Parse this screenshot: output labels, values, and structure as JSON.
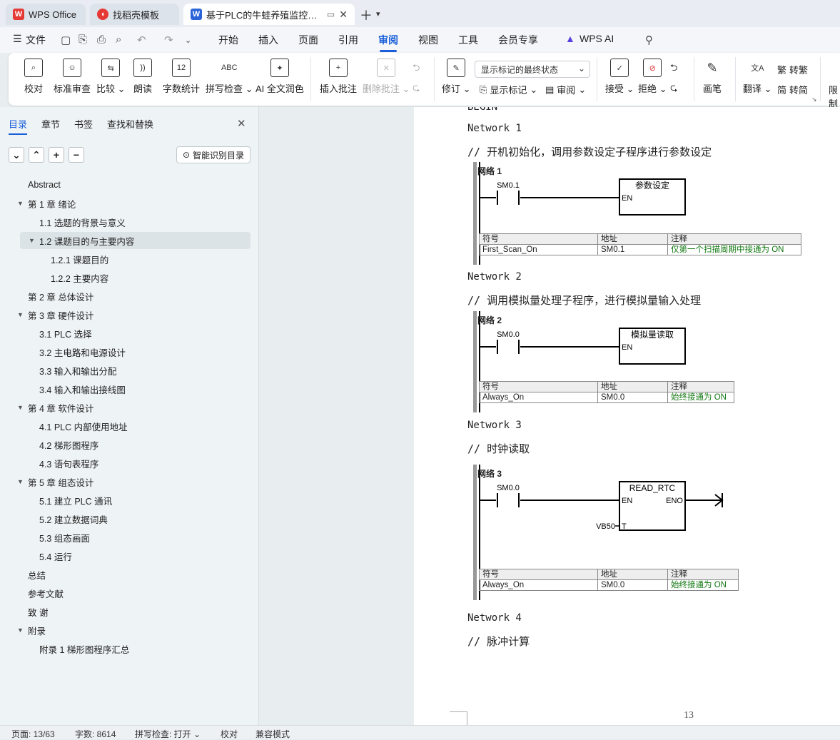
{
  "tabs": [
    {
      "label": "WPS Office"
    },
    {
      "label": "找稻壳模板"
    },
    {
      "label": "基于PLC的牛蛙养殖监控系统"
    }
  ],
  "menu": {
    "file": "文件",
    "items": [
      "开始",
      "插入",
      "页面",
      "引用",
      "审阅",
      "视图",
      "工具",
      "会员专享"
    ],
    "ai": "WPS AI",
    "active": "审阅"
  },
  "ribbon": {
    "proofread": "校对",
    "std_review": "标准审查",
    "compare": "比较",
    "read_aloud": "朗读",
    "word_count": "字数统计",
    "spell_check": "拼写检查",
    "ai_polish": "AI 全文润色",
    "insert_comment": "插入批注",
    "delete_comment": "删除批注",
    "markup_dropdown": "显示标记的最终状态",
    "revise": "修订",
    "show_markup": "显示标记",
    "review": "审阅",
    "accept": "接受",
    "reject": "拒绝",
    "pen": "画笔",
    "translate": "翻译",
    "to_traditional": "转繁",
    "to_simplified": "转简",
    "restrict": "限制"
  },
  "panel": {
    "tabs": [
      "目录",
      "章节",
      "书签",
      "查找和替换"
    ],
    "smart_btn": "智能识别目录",
    "toc": [
      {
        "label": "Abstract",
        "level": 0,
        "arrow": ""
      },
      {
        "label": "第 1 章  绪论",
        "level": 0,
        "arrow": "▼"
      },
      {
        "label": "1.1  选题的背景与意义",
        "level": 1,
        "arrow": ""
      },
      {
        "label": "1.2  课题目的与主要内容",
        "level": 1,
        "arrow": "▼",
        "selected": true
      },
      {
        "label": "1.2.1  课题目的",
        "level": 2,
        "arrow": ""
      },
      {
        "label": "1.2.2  主要内容",
        "level": 2,
        "arrow": ""
      },
      {
        "label": "第 2 章    总体设计",
        "level": 0,
        "arrow": ""
      },
      {
        "label": "第 3 章    硬件设计",
        "level": 0,
        "arrow": "▼"
      },
      {
        "label": "3.1 PLC 选择",
        "level": 1,
        "arrow": ""
      },
      {
        "label": "3.2  主电路和电源设计",
        "level": 1,
        "arrow": ""
      },
      {
        "label": "3.3  输入和输出分配",
        "level": 1,
        "arrow": ""
      },
      {
        "label": "3.4  输入和输出接线图",
        "level": 1,
        "arrow": ""
      },
      {
        "label": "第 4 章    软件设计",
        "level": 0,
        "arrow": "▼"
      },
      {
        "label": "4.1 PLC 内部使用地址",
        "level": 1,
        "arrow": ""
      },
      {
        "label": "4.2  梯形图程序",
        "level": 1,
        "arrow": ""
      },
      {
        "label": "4.3  语句表程序",
        "level": 1,
        "arrow": ""
      },
      {
        "label": "第 5 章    组态设计",
        "level": 0,
        "arrow": "▼"
      },
      {
        "label": "5.1 建立 PLC 通讯",
        "level": 1,
        "arrow": ""
      },
      {
        "label": "5.2  建立数据词典",
        "level": 1,
        "arrow": ""
      },
      {
        "label": "5.3  组态画面",
        "level": 1,
        "arrow": ""
      },
      {
        "label": "5.4 运行",
        "level": 1,
        "arrow": ""
      },
      {
        "label": "总结",
        "level": 0,
        "arrow": ""
      },
      {
        "label": "参考文献",
        "level": 0,
        "arrow": ""
      },
      {
        "label": "致  谢",
        "level": 0,
        "arrow": ""
      },
      {
        "label": "附录",
        "level": 0,
        "arrow": "▼"
      },
      {
        "label": "附录 1  梯形图程序汇总",
        "level": 1,
        "arrow": ""
      }
    ]
  },
  "doc": {
    "begin": "BEGIN",
    "n1": "Network 1",
    "c1": "// 开机初始化，调用参数设定子程序进行参数设定",
    "n2": "Network 2",
    "c2": "// 调用模拟量处理子程序，进行模拟量输入处理",
    "n3": "Network 3",
    "c3": "// 时钟读取",
    "n4": "Network 4",
    "c4": "// 脉冲计算",
    "page_num": "13",
    "ladders": [
      {
        "title": "网络 1",
        "contact": "SM0.1",
        "box": "参数设定",
        "en": "EN",
        "hdr": [
          "符号",
          "地址",
          "注释"
        ],
        "row": [
          "First_Scan_On",
          "SM0.1",
          "仅第一个扫描周期中接通为 ON"
        ]
      },
      {
        "title": "网络 2",
        "contact": "SM0.0",
        "box": "模拟量读取",
        "en": "EN",
        "hdr": [
          "符号",
          "地址",
          "注释"
        ],
        "row": [
          "Always_On",
          "SM0.0",
          "始终接通为 ON"
        ]
      },
      {
        "title": "网络 3",
        "contact": "SM0.0",
        "box": "READ_RTC",
        "en": "EN",
        "eno": "ENO",
        "tlabel": "T",
        "vb": "VB50",
        "hdr": [
          "符号",
          "地址",
          "注释"
        ],
        "row": [
          "Always_On",
          "SM0.0",
          "始终接通为 ON"
        ]
      }
    ]
  },
  "status": {
    "page": "页面: 13/63",
    "words": "字数: 8614",
    "spell": "拼写检查: 打开",
    "proof": "校对",
    "compat": "兼容模式"
  }
}
